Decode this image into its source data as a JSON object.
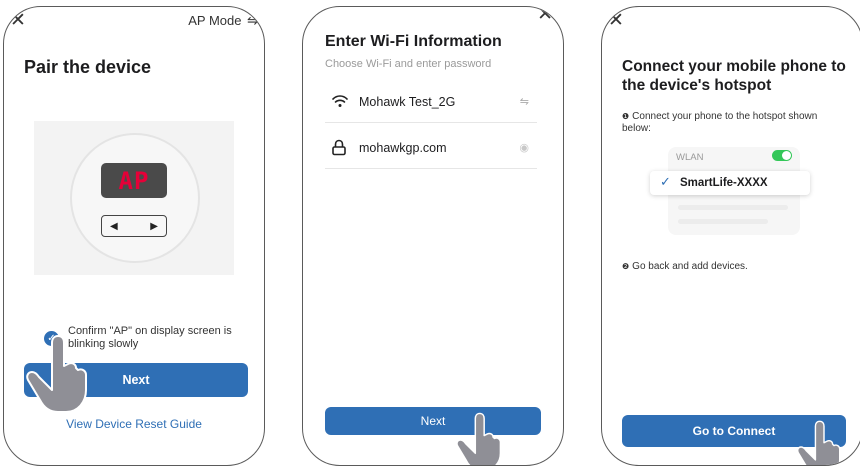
{
  "screen1": {
    "close_glyph": "✕",
    "ap_mode_label": "AP Mode",
    "ap_mode_switch_glyph": "⇋",
    "title": "Pair the device",
    "display_text": "AP",
    "arrow_left": "◀",
    "arrow_right": "▶",
    "checkbox_glyph": "✓",
    "confirm_text": "Confirm \"AP\" on display screen is blinking slowly",
    "next_label": "Next",
    "reset_guide_label": "View Device Reset Guide",
    "icons": [
      "close-icon",
      "switch-mode-icon",
      "checkbox-checked-icon",
      "hand-pointer-icon"
    ]
  },
  "screen2": {
    "close_glyph": "✕",
    "title": "Enter Wi-Fi Information",
    "subtitle": "Choose Wi-Fi and enter password",
    "wifi_name": "Mohawk Test_2G",
    "switch_glyph": "⇋",
    "password": "mohawkgp.com",
    "eye_glyph": "◉",
    "next_label": "Next",
    "icons": [
      "wifi-icon",
      "switch-network-icon",
      "lock-icon",
      "eye-icon",
      "hand-pointer-icon"
    ]
  },
  "screen3": {
    "close_glyph": "✕",
    "title": "Connect your mobile phone to the device's hotspot",
    "step1_bullet": "❶",
    "step1_text": "Connect your phone to the hotspot shown below:",
    "wlan_label": "WLAN",
    "tick_glyph": "✓",
    "network_name": "SmartLife-XXXX",
    "step2_bullet": "❷",
    "step2_text": "Go back and add devices.",
    "connect_label": "Go to Connect",
    "icons": [
      "toggle-on-icon",
      "checkmark-icon",
      "hand-pointer-icon"
    ]
  },
  "colors": {
    "primary": "#2f6fb5",
    "display_red": "#e60038",
    "toggle_green": "#34c759",
    "hand": "#8f8f96"
  }
}
